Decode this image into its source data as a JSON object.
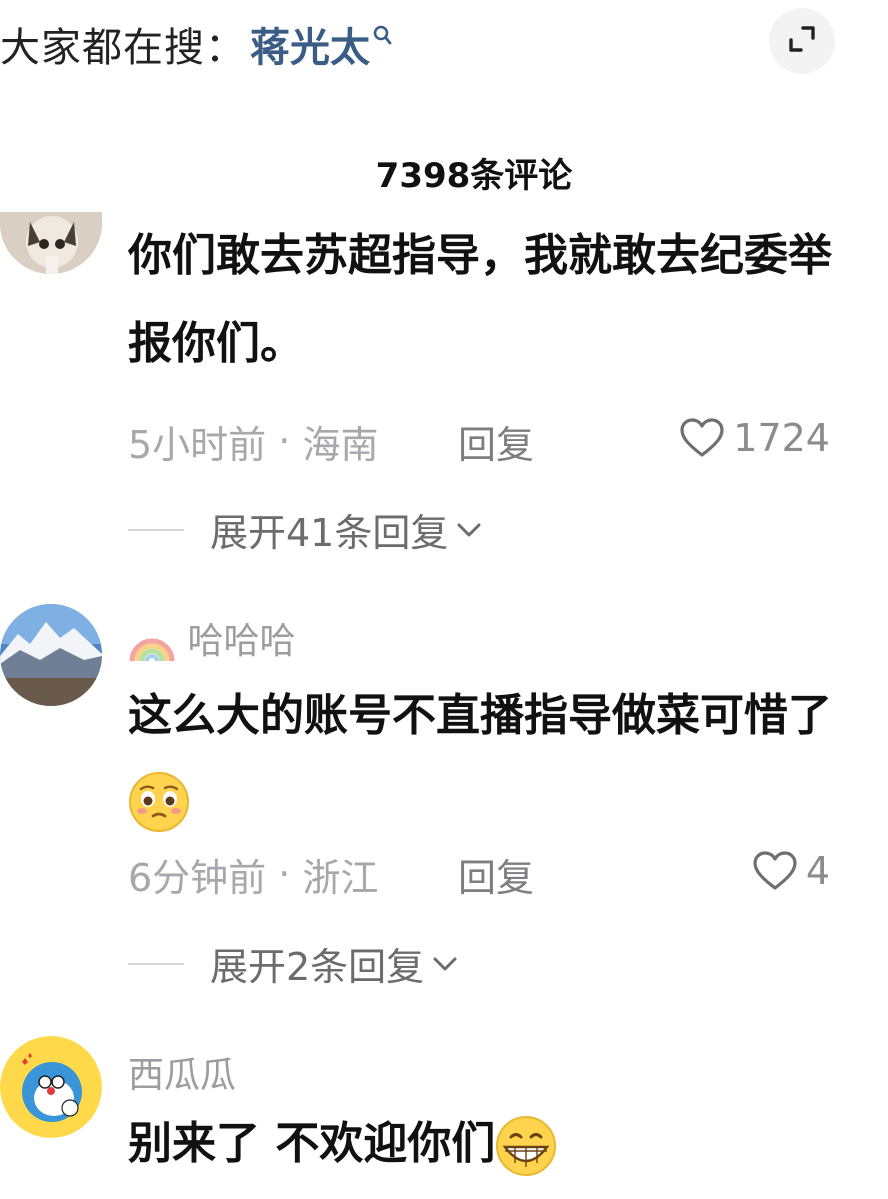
{
  "search_hint": {
    "prefix": "大家都在搜：",
    "term": "蒋光太"
  },
  "comments_header": {
    "count_label": "7398条评论"
  },
  "comments": [
    {
      "username": "",
      "text_line1": "你们敢去苏超指导，我就敢去纪委举",
      "text_line2": "报你们。",
      "time": "5小时前",
      "location": "海南",
      "reply_label": "回复",
      "likes": "1724",
      "expand_label": "展开41条回复"
    },
    {
      "username": "哈哈哈",
      "text_line1": "这么大的账号不直播指导做菜可惜了",
      "time": "6分钟前",
      "location": "浙江",
      "reply_label": "回复",
      "likes": "4",
      "expand_label": "展开2条回复"
    },
    {
      "username": "西瓜瓜",
      "text_line1": "别来了 不欢迎你们"
    }
  ],
  "colors": {
    "search_term": "#3a5d86",
    "meta_gray": "#a7a7ad",
    "text_dark": "#111111"
  },
  "icons": [
    "search-icon",
    "fullscreen-icon",
    "heart-outline-icon",
    "chevron-down-icon",
    "rainbow-emoji",
    "pleading-face-emoji",
    "grinning-face-emoji"
  ]
}
